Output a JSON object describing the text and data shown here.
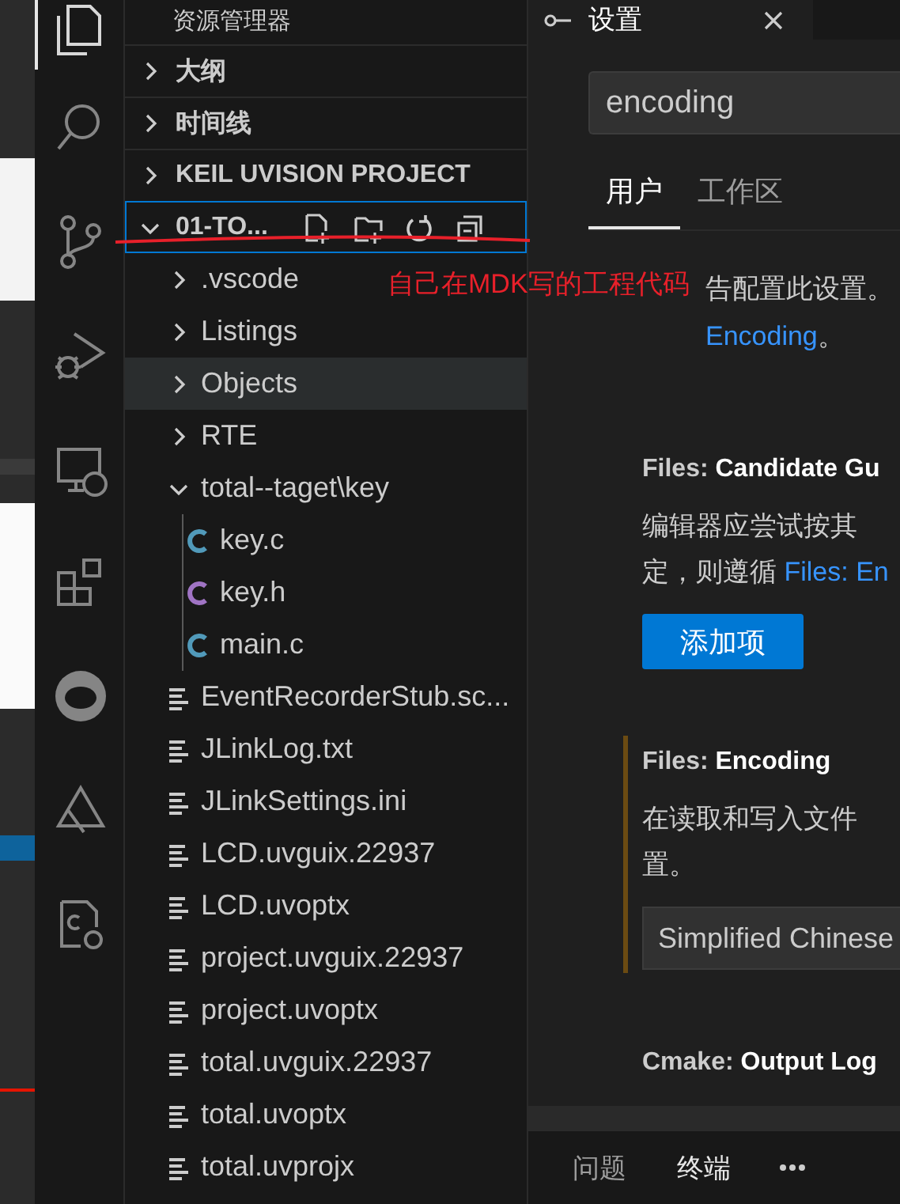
{
  "activity_bar": {
    "items": [
      {
        "kind": "files",
        "selected": true
      },
      {
        "kind": "search",
        "selected": false
      },
      {
        "kind": "source-control",
        "selected": false
      },
      {
        "kind": "run-debug",
        "selected": false
      },
      {
        "kind": "remote",
        "selected": false
      },
      {
        "kind": "extensions",
        "selected": false
      },
      {
        "kind": "piggy",
        "selected": false
      },
      {
        "kind": "triangle",
        "selected": false
      },
      {
        "kind": "cpp-settings",
        "selected": false
      }
    ]
  },
  "sidebar": {
    "title": "资源管理器",
    "sections": [
      {
        "label": "大纲",
        "expanded": false
      },
      {
        "label": "时间线",
        "expanded": false
      },
      {
        "label": "KEIL UVISION PROJECT",
        "expanded": false
      },
      {
        "label": "01-TO...",
        "expanded": true,
        "focused": true,
        "actions": [
          {
            "kind": "new-file"
          },
          {
            "kind": "new-folder"
          },
          {
            "kind": "refresh"
          },
          {
            "kind": "collapse"
          }
        ],
        "children": [
          {
            "label": ".vscode",
            "kind": "folder",
            "expanded": false,
            "selected": false
          },
          {
            "label": "Listings",
            "kind": "folder",
            "expanded": false,
            "selected": false
          },
          {
            "label": "Objects",
            "kind": "folder",
            "expanded": false,
            "selected": true
          },
          {
            "label": "RTE",
            "kind": "folder",
            "expanded": false,
            "selected": false
          },
          {
            "label": "total--taget\\key",
            "kind": "folder",
            "expanded": true,
            "selected": false,
            "children": [
              {
                "label": "key.c",
                "kind": "c",
                "selected": false
              },
              {
                "label": "key.h",
                "kind": "h",
                "selected": false
              },
              {
                "label": "main.c",
                "kind": "c",
                "selected": false
              }
            ]
          },
          {
            "label": "EventRecorderStub.sc...",
            "kind": "file",
            "selected": false
          },
          {
            "label": "JLinkLog.txt",
            "kind": "file",
            "selected": false
          },
          {
            "label": "JLinkSettings.ini",
            "kind": "file",
            "selected": false
          },
          {
            "label": "LCD.uvguix.22937",
            "kind": "file",
            "selected": false
          },
          {
            "label": "LCD.uvoptx",
            "kind": "file",
            "selected": false
          },
          {
            "label": "project.uvguix.22937",
            "kind": "file",
            "selected": false
          },
          {
            "label": "project.uvoptx",
            "kind": "file",
            "selected": false
          },
          {
            "label": "total.uvguix.22937",
            "kind": "file",
            "selected": false
          },
          {
            "label": "total.uvoptx",
            "kind": "file",
            "selected": false
          },
          {
            "label": "total.uvprojx",
            "kind": "file",
            "selected": false
          }
        ]
      }
    ]
  },
  "annotation": {
    "text": "自己在MDK写的工程代码"
  },
  "editor": {
    "tab": {
      "title": "设置"
    },
    "search": {
      "value": "encoding"
    },
    "scope_tabs": [
      {
        "label": "用户",
        "selected": true
      },
      {
        "label": "工作区",
        "selected": false
      }
    ],
    "settings": [
      {
        "kind": "tail",
        "text": "告配置此设置。",
        "link": "Encoding",
        "after": "。"
      },
      {
        "kind": "list",
        "category": "Files: ",
        "name": "Candidate Gu",
        "modified": false,
        "description": "编辑器应尝试按其",
        "description_2": "定，则遵循 ",
        "description_link": "Files: En",
        "button": "添加项"
      },
      {
        "kind": "dropdown",
        "category": "Files: ",
        "name": "Encoding",
        "modified": true,
        "description": "在读取和写入文件",
        "description_2": "置。",
        "value": "Simplified Chinese"
      },
      {
        "kind": "heading",
        "category": "Cmake: ",
        "name": "Output Log",
        "modified": false
      }
    ]
  },
  "panel": {
    "tabs": [
      {
        "label": "问题",
        "selected": false
      },
      {
        "label": "终端",
        "selected": true
      }
    ]
  }
}
